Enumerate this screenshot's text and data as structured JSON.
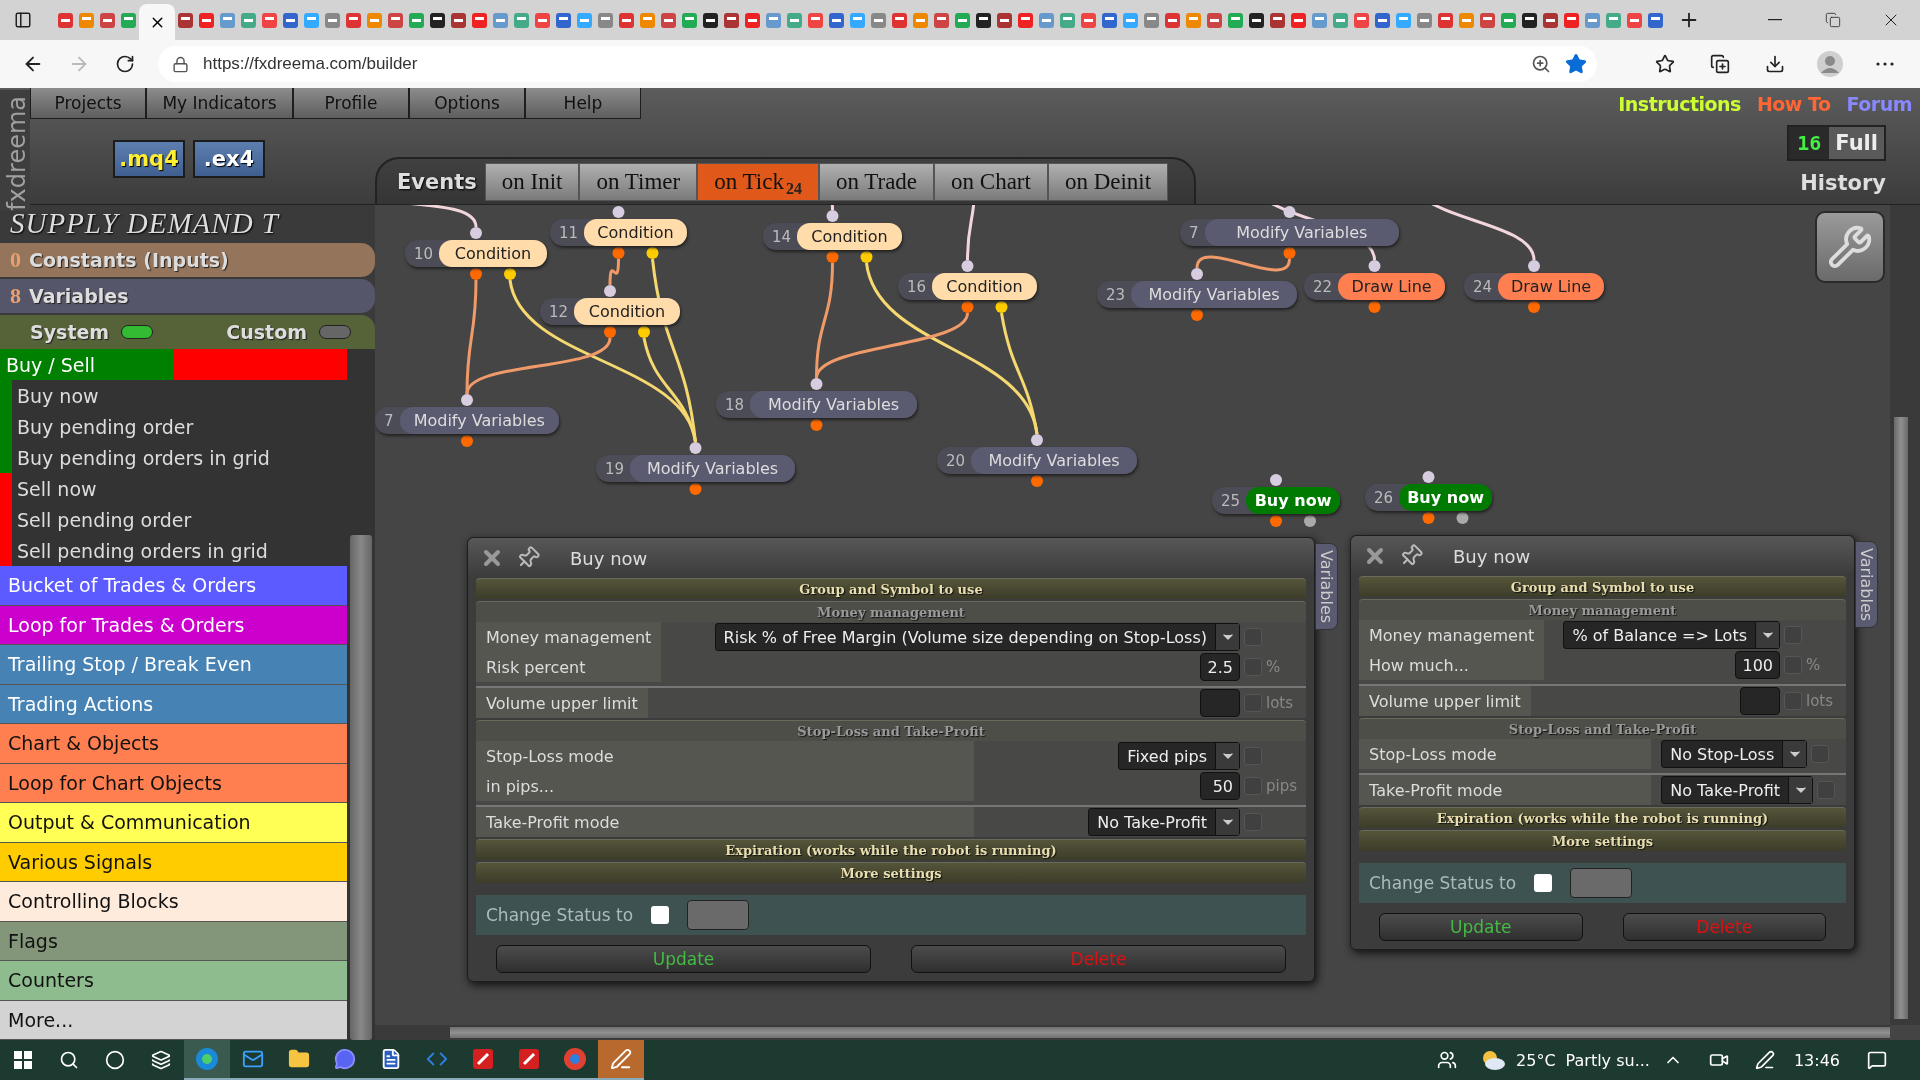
{
  "browser": {
    "url": "https://fxdreema.com/builder"
  },
  "brand": "fxdreema",
  "menu": [
    "Projects",
    "My Indicators",
    "Profile",
    "Options",
    "Help"
  ],
  "links": [
    {
      "label": "Instructions",
      "color": "#ccff33"
    },
    {
      "label": "How To",
      "color": "#ff6633"
    },
    {
      "label": "Forum",
      "color": "#8888ff"
    }
  ],
  "exports": [
    ".mq4",
    ".ex4"
  ],
  "history": {
    "count": "16",
    "mode": "Full",
    "label": "History"
  },
  "events": {
    "label": "Events",
    "tabs": [
      {
        "label": "on Init",
        "selected": false
      },
      {
        "label": "on Timer",
        "selected": false
      },
      {
        "label": "on Tick",
        "count": "24",
        "selected": true
      },
      {
        "label": "on Trade",
        "selected": false
      },
      {
        "label": "on Chart",
        "selected": false
      },
      {
        "label": "on Deinit",
        "selected": false
      }
    ]
  },
  "project": {
    "title": "SUPPLY DEMAND T",
    "constants": {
      "count": "0",
      "label": "Constants (Inputs)"
    },
    "variables": {
      "count": "8",
      "label": "Variables"
    },
    "toggles": [
      {
        "label": "System",
        "on": true
      },
      {
        "label": "Custom",
        "on": false
      }
    ]
  },
  "palette": {
    "group": {
      "label": "Buy / Sell",
      "expanded": true,
      "items": [
        {
          "label": "Buy now",
          "color": "#008000"
        },
        {
          "label": "Buy pending order",
          "color": "#008000"
        },
        {
          "label": "Buy pending orders in grid",
          "color": "#008000"
        },
        {
          "label": "Sell now",
          "color": "#ff0000"
        },
        {
          "label": "Sell pending order",
          "color": "#ff0000"
        },
        {
          "label": "Sell pending orders in grid",
          "color": "#ff0000"
        }
      ]
    },
    "categories": [
      {
        "label": "Bucket of Trades & Orders",
        "color": "#5b5bff"
      },
      {
        "label": "Loop for Trades & Orders",
        "color": "#cc00cc"
      },
      {
        "label": "Trailing Stop / Break Even",
        "color": "#4682b4"
      },
      {
        "label": "Trading Actions",
        "color": "#4682b4"
      },
      {
        "label": "Chart & Objects",
        "color": "#ff7f50"
      },
      {
        "label": "Loop for Chart Objects",
        "color": "#ff7f50"
      },
      {
        "label": "Output & Communication",
        "color": "#ffff55"
      },
      {
        "label": "Various Signals",
        "color": "#ffcc00"
      },
      {
        "label": "Controlling Blocks",
        "color": "#ffebdc"
      },
      {
        "label": "Flags",
        "color": "#84967a"
      },
      {
        "label": "Counters",
        "color": "#8fbc8f"
      },
      {
        "label": "More...",
        "color": "#d3d3d3"
      }
    ]
  },
  "canvas": {
    "nodes": [
      {
        "number": "10",
        "label": "Condition",
        "kind": "condition"
      },
      {
        "number": "11",
        "label": "Condition",
        "kind": "condition"
      },
      {
        "number": "12",
        "label": "Condition",
        "kind": "condition"
      },
      {
        "number": "14",
        "label": "Condition",
        "kind": "condition"
      },
      {
        "number": "16",
        "label": "Condition",
        "kind": "condition"
      },
      {
        "number": "7",
        "label": "Modify Variables",
        "kind": "modify"
      },
      {
        "number": "19",
        "label": "Modify Variables",
        "kind": "modify"
      },
      {
        "number": "18",
        "label": "Modify Variables",
        "kind": "modify"
      },
      {
        "number": "20",
        "label": "Modify Variables",
        "kind": "modify"
      },
      {
        "number": "7",
        "label": "Modify Variables",
        "kind": "modify"
      },
      {
        "number": "23",
        "label": "Modify Variables",
        "kind": "modify"
      },
      {
        "number": "22",
        "label": "Draw Line",
        "kind": "draw"
      },
      {
        "number": "24",
        "label": "Draw Line",
        "kind": "draw"
      },
      {
        "number": "25",
        "label": "Buy now",
        "kind": "buy"
      },
      {
        "number": "26",
        "label": "Buy now",
        "kind": "buy"
      }
    ]
  },
  "panels": [
    {
      "title": "Buy now",
      "side_tab": "Variables",
      "sections": [
        {
          "title": "Group and Symbol to use",
          "expanded": false
        },
        {
          "title": "Money management",
          "expanded": true,
          "groups": [
            [
              {
                "label": "Money management",
                "kind": "select",
                "value": "Risk % of Free Margin (Volume size depending on Stop-Loss)",
                "checked": false
              },
              {
                "label": "Risk percent",
                "kind": "number",
                "value": "2.5",
                "unit": "%",
                "checked": false
              }
            ],
            [
              {
                "label": "Volume upper limit",
                "kind": "number",
                "unit": "lots",
                "checked": false
              }
            ]
          ]
        },
        {
          "title": "Stop-Loss and Take-Profit",
          "expanded": true,
          "groups": [
            [
              {
                "label": "Stop-Loss mode",
                "kind": "select",
                "value": "Fixed pips",
                "checked": false
              },
              {
                "label": "in pips...",
                "kind": "number",
                "value": "50",
                "unit": "pips",
                "checked": false
              }
            ],
            [
              {
                "label": "Take-Profit mode",
                "kind": "select",
                "value": "No Take-Profit",
                "checked": false
              }
            ]
          ]
        },
        {
          "title": "Expiration (works while the robot is running)",
          "expanded": false
        },
        {
          "title": "More settings",
          "expanded": false
        }
      ],
      "status": {
        "label": "Change Status to",
        "checked": false
      },
      "buttons": [
        {
          "label": "Update",
          "kind": "confirm"
        },
        {
          "label": "Delete",
          "kind": "danger"
        }
      ]
    },
    {
      "title": "Buy now",
      "side_tab": "Variables",
      "sections": [
        {
          "title": "Group and Symbol to use",
          "expanded": false
        },
        {
          "title": "Money management",
          "expanded": true,
          "groups": [
            [
              {
                "label": "Money management",
                "kind": "select",
                "value": "% of Balance => Lots",
                "checked": false
              },
              {
                "label": "How much...",
                "kind": "number",
                "value": "100",
                "unit": "%",
                "checked": false
              }
            ],
            [
              {
                "label": "Volume upper limit",
                "kind": "number",
                "unit": "lots",
                "checked": false
              }
            ]
          ]
        },
        {
          "title": "Stop-Loss and Take-Profit",
          "expanded": true,
          "groups": [
            [
              {
                "label": "Stop-Loss mode",
                "kind": "select",
                "value": "No Stop-Loss",
                "checked": false
              }
            ],
            [
              {
                "label": "Take-Profit mode",
                "kind": "select",
                "value": "No Take-Profit",
                "checked": false
              }
            ]
          ]
        },
        {
          "title": "Expiration (works while the robot is running)",
          "expanded": false
        },
        {
          "title": "More settings",
          "expanded": false
        }
      ],
      "status": {
        "label": "Change Status to",
        "checked": false
      },
      "buttons": [
        {
          "label": "Update",
          "kind": "confirm"
        },
        {
          "label": "Delete",
          "kind": "danger"
        }
      ]
    }
  ],
  "taskbar": {
    "temperature": "25°C",
    "weather": "Partly su...",
    "time": "13:46"
  }
}
